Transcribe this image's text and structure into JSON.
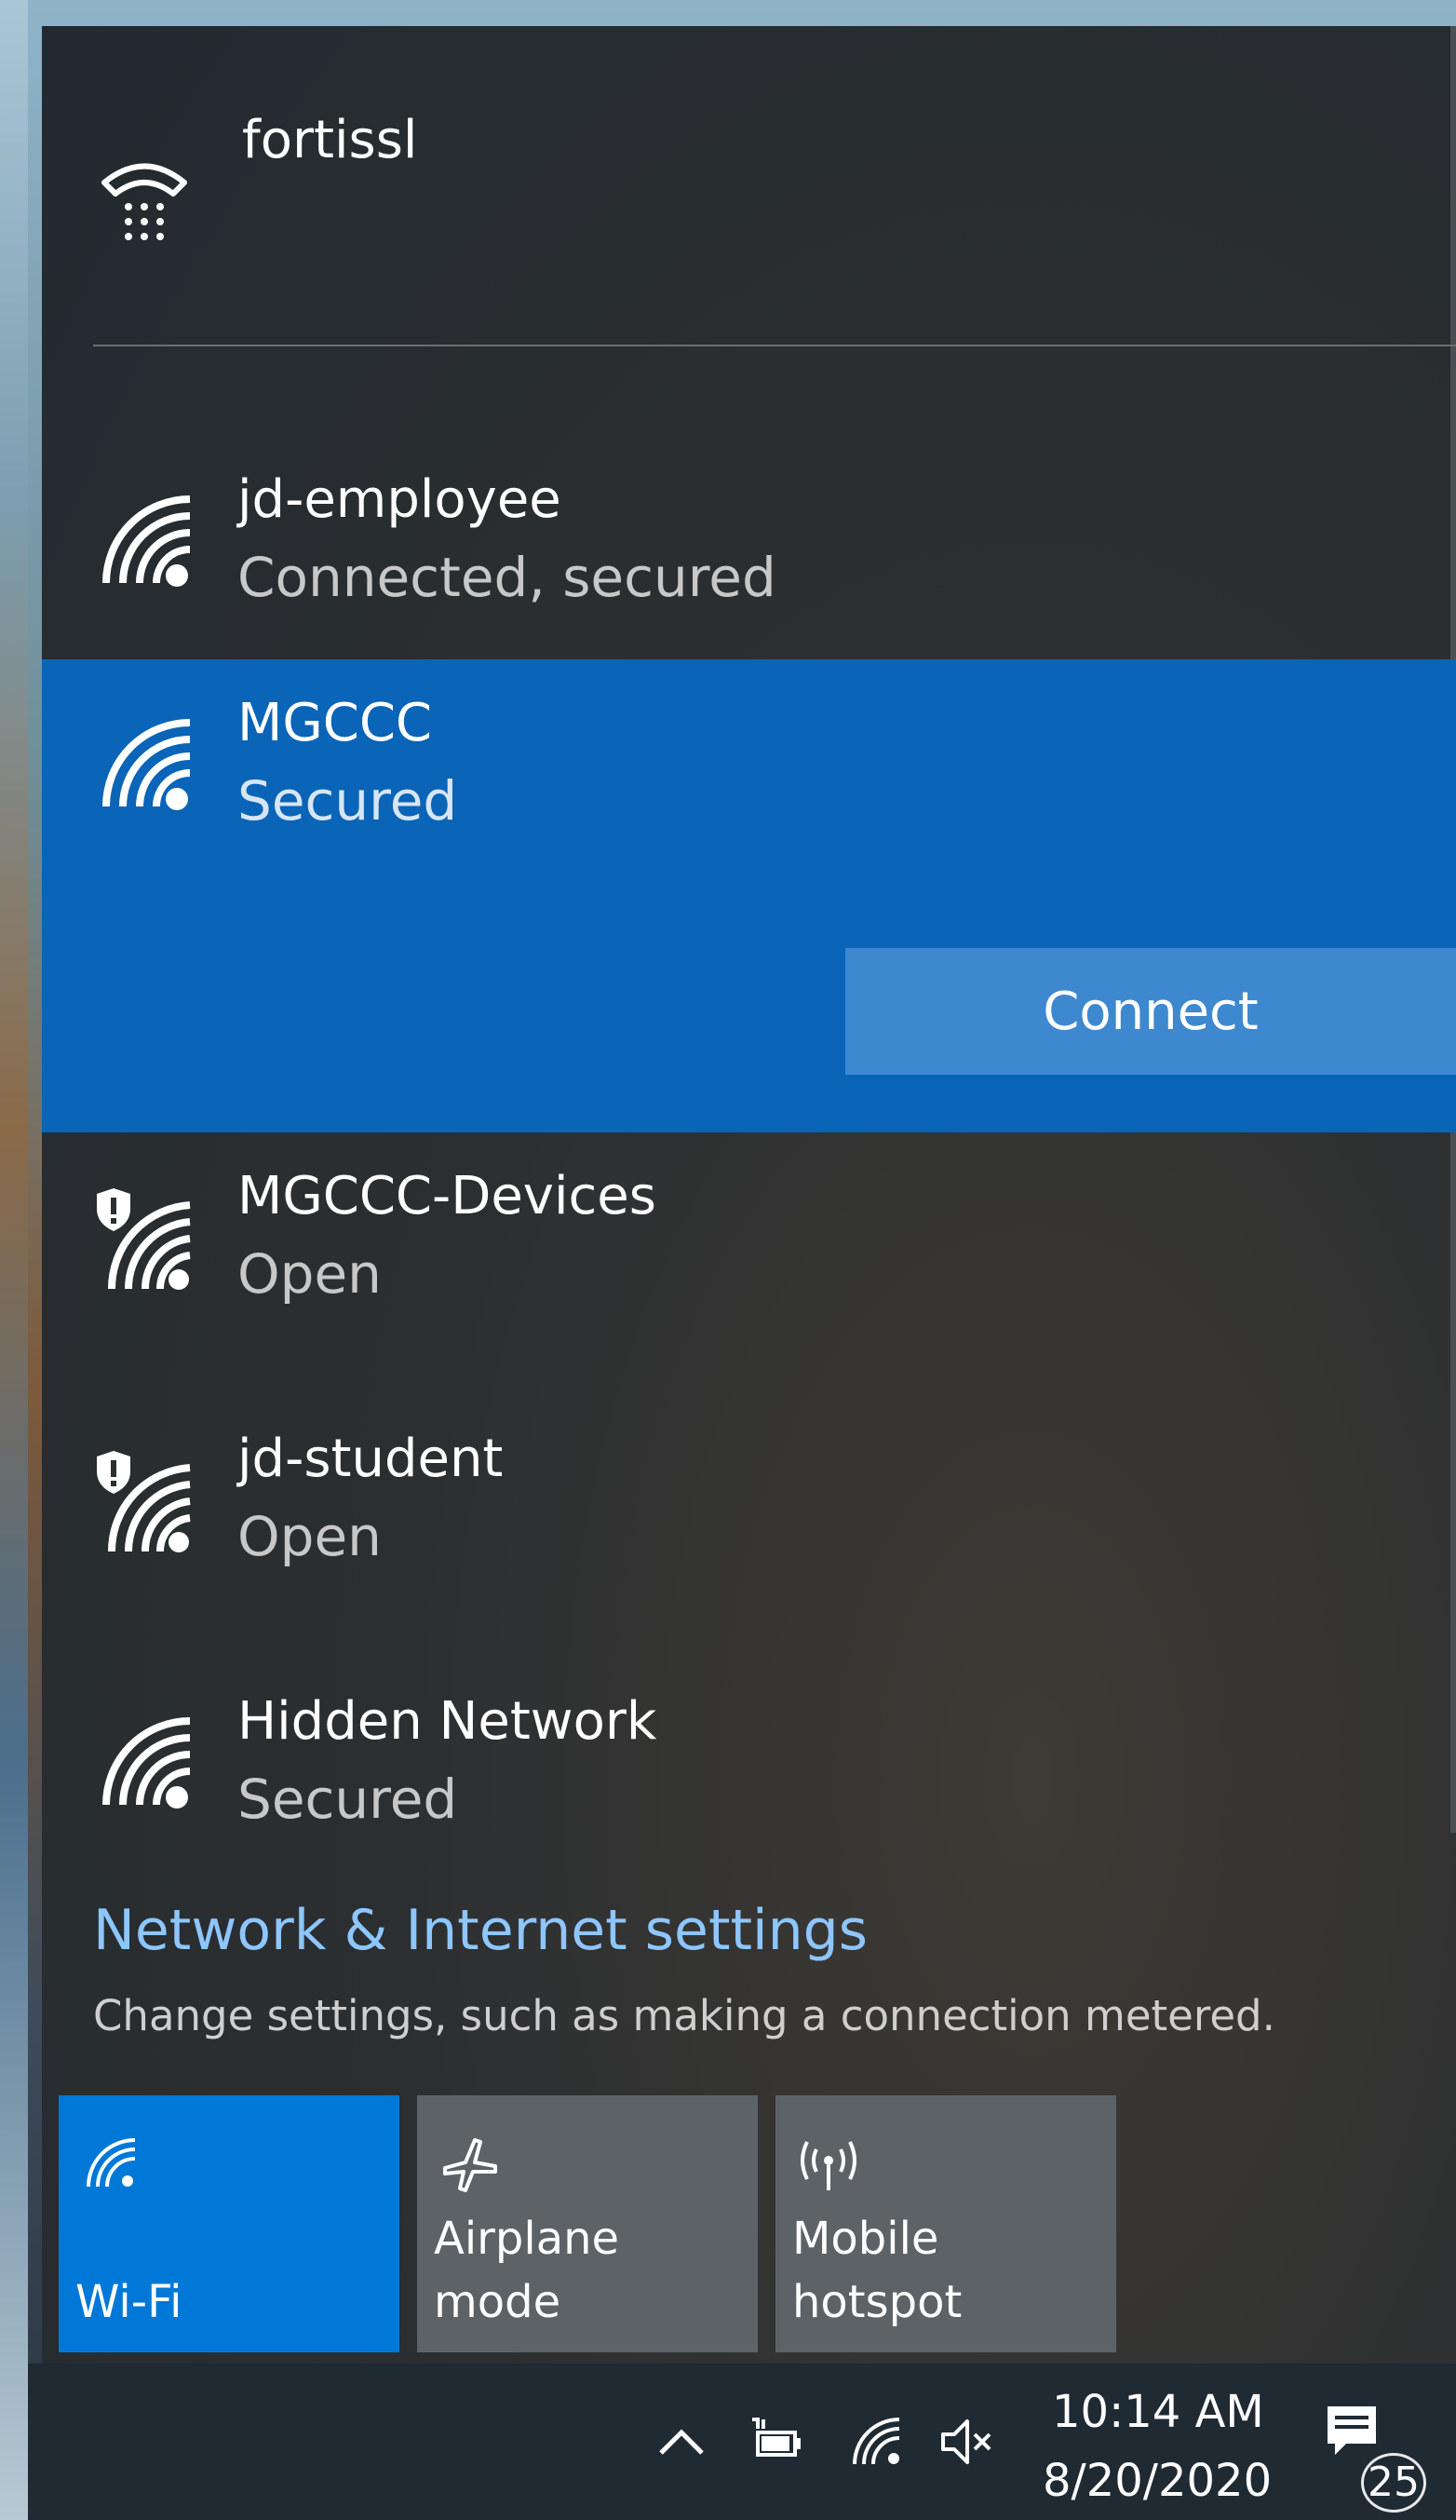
{
  "vpn": {
    "name": "fortissl",
    "icon": "vpn-dialup-icon"
  },
  "networks": [
    {
      "name": "jd-employee",
      "status": "Connected, secured",
      "icon": "wifi-icon"
    },
    {
      "name": "MGCCC",
      "status": "Secured",
      "icon": "wifi-icon",
      "selected": true,
      "connect_label": "Connect"
    },
    {
      "name": "MGCCC-Devices",
      "status": "Open",
      "icon": "wifi-open-warning-icon"
    },
    {
      "name": "jd-student",
      "status": "Open",
      "icon": "wifi-open-warning-icon"
    },
    {
      "name": "Hidden Network",
      "status": "Secured",
      "icon": "wifi-icon"
    }
  ],
  "settings": {
    "link": "Network & Internet settings",
    "description": "Change settings, such as making a connection metered."
  },
  "quick_actions": [
    {
      "label": "Wi-Fi",
      "icon": "wifi-icon",
      "active": true
    },
    {
      "label": "Airplane mode",
      "icon": "airplane-icon",
      "active": false
    },
    {
      "label": "Mobile hotspot",
      "label_lines": [
        "Mobile",
        "hotspot"
      ],
      "icon": "hotspot-icon",
      "active": false
    }
  ],
  "taskbar": {
    "time": "10:14 AM",
    "date": "8/20/2020",
    "notification_count": "25",
    "icons": [
      "chevron-up-icon",
      "power-icon",
      "wifi-icon",
      "volume-muted-icon",
      "notification-icon"
    ]
  },
  "colors": {
    "accent": "#0078d7",
    "selected_row": "#0a64b7",
    "link": "#8ec6ff",
    "panel": "#2c2f31"
  }
}
